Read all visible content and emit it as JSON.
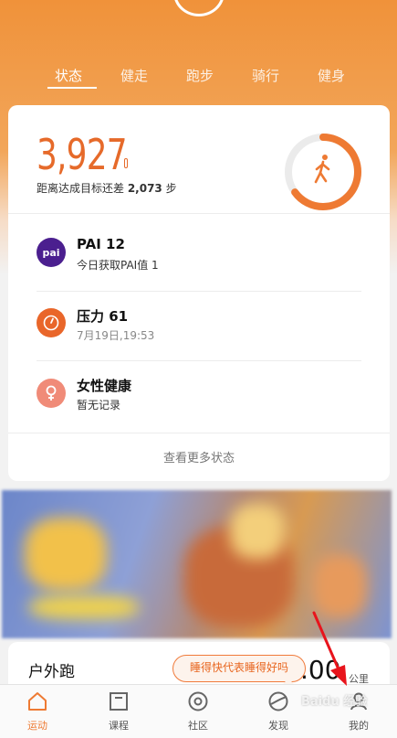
{
  "top_tabs": [
    "状态",
    "健走",
    "跑步",
    "骑行",
    "健身"
  ],
  "active_tab": "状态",
  "summary": {
    "steps": "3,927",
    "goal_prefix": "距离达成目标还差 ",
    "goal_remaining": "2,073",
    "goal_suffix": " 步",
    "progress": 0.65
  },
  "status_rows": [
    {
      "icon": "pai-icon",
      "icon_text": "pai",
      "title": "PAI 12",
      "subtitle": "今日获取PAI值 1"
    },
    {
      "icon": "gauge-icon",
      "title": "压力 61",
      "subtitle": "7月19日,19:53"
    },
    {
      "icon": "female-icon",
      "title": "女性健康",
      "subtitle": "暂无记录"
    }
  ],
  "more_link": "查看更多状态",
  "outdoor": {
    "title": "户外跑",
    "distance": ".00",
    "unit": "公里"
  },
  "tip": "睡得快代表睡得好吗",
  "bottom_nav": [
    {
      "label": "运动",
      "icon": "home-icon"
    },
    {
      "label": "课程",
      "icon": "course-icon"
    },
    {
      "label": "社区",
      "icon": "community-icon"
    },
    {
      "label": "发现",
      "icon": "discover-icon"
    },
    {
      "label": "我的",
      "icon": "profile-icon"
    }
  ],
  "watermark": "Baidu 经验",
  "colors": {
    "accent": "#ee7a33",
    "ring_track": "#ebebeb",
    "pai": "#4b1f8f",
    "female": "#f08b78"
  }
}
